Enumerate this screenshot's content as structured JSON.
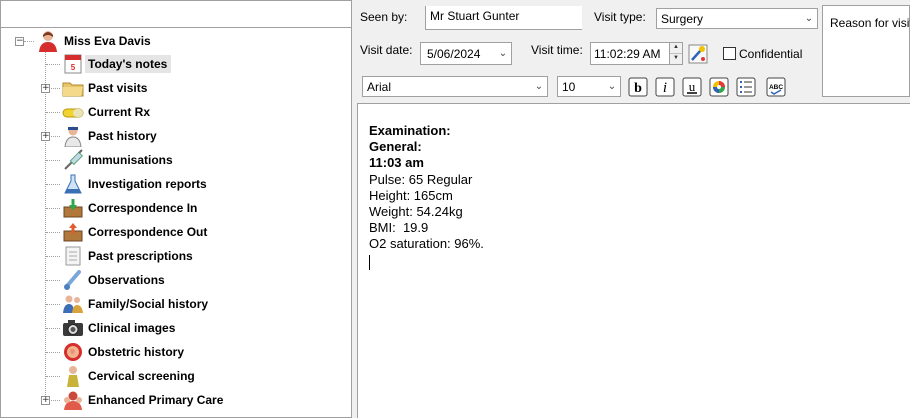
{
  "tree": {
    "root": {
      "label": "Miss Eva Davis",
      "icon": "patient-icon"
    },
    "items": [
      {
        "label": "Today's notes",
        "icon": "calendar-notes-icon",
        "selected": true,
        "expandable": false
      },
      {
        "label": "Past visits",
        "icon": "folder-icon",
        "selected": false,
        "expandable": true
      },
      {
        "label": "Current Rx",
        "icon": "pill-icon",
        "selected": false,
        "expandable": false
      },
      {
        "label": "Past history",
        "icon": "doctor-icon",
        "selected": false,
        "expandable": true
      },
      {
        "label": "Immunisations",
        "icon": "syringe-icon",
        "selected": false,
        "expandable": false
      },
      {
        "label": "Investigation reports",
        "icon": "flask-icon",
        "selected": false,
        "expandable": false
      },
      {
        "label": "Correspondence In",
        "icon": "inbox-icon",
        "selected": false,
        "expandable": false
      },
      {
        "label": "Correspondence Out",
        "icon": "outbox-icon",
        "selected": false,
        "expandable": false
      },
      {
        "label": "Past prescriptions",
        "icon": "prescription-icon",
        "selected": false,
        "expandable": false
      },
      {
        "label": "Observations",
        "icon": "thermometer-icon",
        "selected": false,
        "expandable": false
      },
      {
        "label": "Family/Social history",
        "icon": "family-icon",
        "selected": false,
        "expandable": false
      },
      {
        "label": "Clinical images",
        "icon": "camera-icon",
        "selected": false,
        "expandable": false
      },
      {
        "label": "Obstetric history",
        "icon": "obstetric-icon",
        "selected": false,
        "expandable": false
      },
      {
        "label": "Cervical screening",
        "icon": "woman-icon",
        "selected": false,
        "expandable": false
      },
      {
        "label": "Enhanced Primary Care",
        "icon": "care-team-icon",
        "selected": false,
        "expandable": true
      }
    ]
  },
  "visit": {
    "seen_by_label": "Seen by:",
    "seen_by_value": "Mr Stuart Gunter",
    "visit_type_label": "Visit type:",
    "visit_type_value": "Surgery",
    "visit_date_label": "Visit date:",
    "visit_date_value": "5/06/2024",
    "visit_time_label": "Visit time:",
    "visit_time_value": "11:02:29 AM",
    "confidential_label": "Confidential",
    "confidential_checked": false,
    "reason_label": "Reason for visit"
  },
  "toolbar": {
    "font_value": "Arial",
    "size_value": "10",
    "buttons": [
      "bold-icon",
      "italic-icon",
      "underline-icon",
      "color-icon",
      "list-icon",
      "spellcheck-icon"
    ]
  },
  "notes": {
    "lines": [
      {
        "text": "Examination:",
        "bold": true
      },
      {
        "text": "General:",
        "bold": true
      },
      {
        "text": "11:03 am",
        "bold": true
      },
      {
        "text": "Pulse: 65 Regular",
        "bold": false
      },
      {
        "text": "Height: 165cm",
        "bold": false
      },
      {
        "text": "Weight: 54.24kg",
        "bold": false
      },
      {
        "text": "BMI:  19.9",
        "bold": false
      },
      {
        "text": "O2 saturation: 96%.",
        "bold": false
      }
    ]
  }
}
